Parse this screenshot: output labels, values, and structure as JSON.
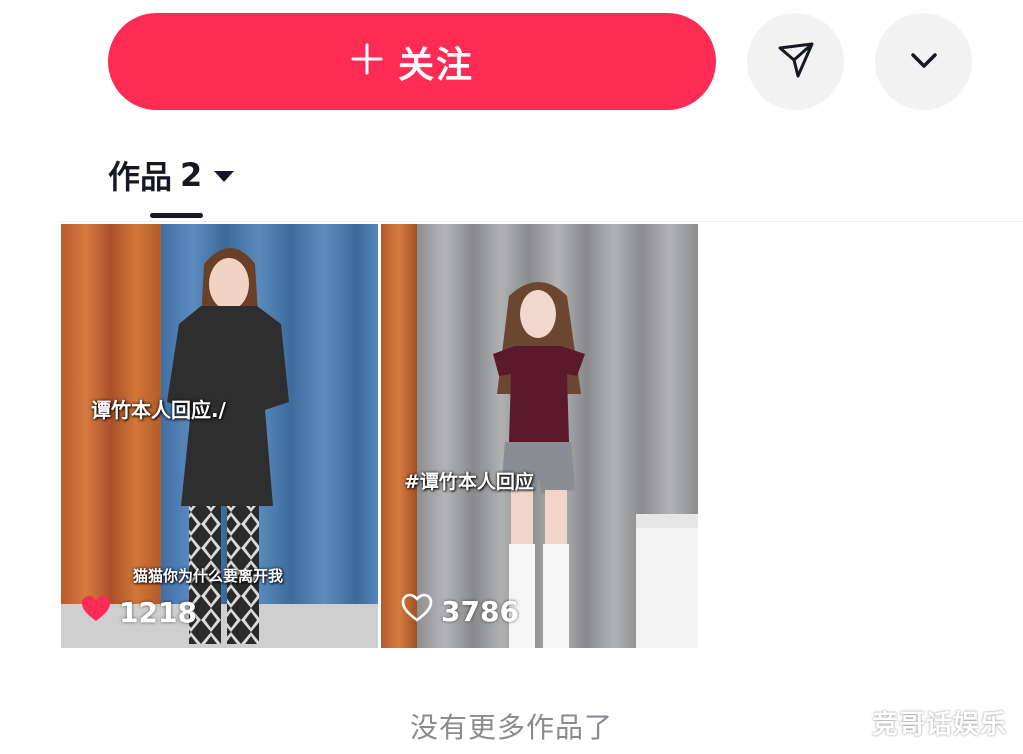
{
  "actions": {
    "follow_label": "关注",
    "follow_icon": "plus-icon",
    "share_icon": "send-icon",
    "more_icon": "chevron-down-icon",
    "accent_color": "#fe2c55"
  },
  "tabs": {
    "works_label": "作品",
    "works_count": "2"
  },
  "videos": [
    {
      "caption_main": "谭竹本人回应./",
      "caption_sub": "猫猫你为什么要离开我",
      "likes": "1218",
      "liked": true,
      "like_icon": "heart-filled-icon"
    },
    {
      "caption_main": "#谭竹本人回应",
      "likes": "3786",
      "liked": false,
      "like_icon": "heart-outline-icon"
    }
  ],
  "footer": {
    "no_more_text": "没有更多作品了"
  },
  "watermark": "竞哥话娱乐"
}
